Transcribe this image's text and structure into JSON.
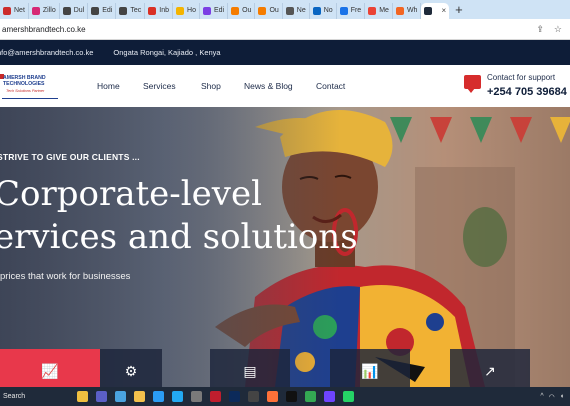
{
  "browser": {
    "tabs": [
      {
        "label": "Net",
        "icon": "tab-favicon",
        "color": "#cc2c2c"
      },
      {
        "label": "Zillo",
        "icon": "tab-favicon",
        "color": "#d62976"
      },
      {
        "label": "Dul",
        "icon": "tab-favicon",
        "color": "#444444"
      },
      {
        "label": "Edi",
        "icon": "tab-favicon",
        "color": "#444444"
      },
      {
        "label": "Tec",
        "icon": "tab-favicon",
        "color": "#444444"
      },
      {
        "label": "Inb",
        "icon": "tab-favicon",
        "color": "#d93025"
      },
      {
        "label": "Ho",
        "icon": "tab-favicon",
        "color": "#f4b400"
      },
      {
        "label": "Edi",
        "icon": "tab-favicon",
        "color": "#7b3fe4"
      },
      {
        "label": "Ou",
        "icon": "tab-favicon",
        "color": "#f57c00"
      },
      {
        "label": "Ou",
        "icon": "tab-favicon",
        "color": "#f57c00"
      },
      {
        "label": "Ne",
        "icon": "tab-favicon",
        "color": "#555555"
      },
      {
        "label": "No",
        "icon": "tab-favicon",
        "color": "#0a66c2"
      },
      {
        "label": "Fre",
        "icon": "tab-favicon",
        "color": "#1a73e8"
      },
      {
        "label": "Me",
        "icon": "tab-favicon",
        "color": "#ea4335"
      },
      {
        "label": "Wh",
        "icon": "tab-favicon",
        "color": "#f26522"
      }
    ],
    "active_tab_close": "×",
    "new_tab": "+",
    "url": "amershbrandtech.co.ke"
  },
  "site": {
    "email": "nfo@amershbrandtech.co.ke",
    "location": "Ongata Rongai, Kajiado , Kenya",
    "logo": {
      "line1": "AMERSH BRAND",
      "line2": "TECHNOLOGIES",
      "tagline": "Tech Solutions Partner"
    },
    "nav": [
      "Home",
      "Services",
      "Shop",
      "News & Blog",
      "Contact"
    ],
    "support": {
      "label": "Contact for support",
      "phone": "+254 705 39684"
    },
    "hero": {
      "eyebrow": "STRIVE TO GIVE OUR CLIENTS ...",
      "headline_line1": "Corporate-level",
      "headline_line2": "ervices and solutions",
      "subtext": "prices that work for businesses"
    },
    "colors": {
      "navy": "#0e1d38",
      "accent_red": "#e8384b"
    }
  },
  "taskbar": {
    "search_label": "Search",
    "apps": [
      {
        "name": "file-explorer-icon",
        "color": "#f0c040"
      },
      {
        "name": "teams-icon",
        "color": "#5b5fc7"
      },
      {
        "name": "store-icon",
        "color": "#4aa3df"
      },
      {
        "name": "folder-icon",
        "color": "#f3c14c"
      },
      {
        "name": "edge-icon",
        "color": "#2b9df4"
      },
      {
        "name": "vscode-icon",
        "color": "#23a9f2"
      },
      {
        "name": "app-icon",
        "color": "#7a7a7a"
      },
      {
        "name": "filezilla-icon",
        "color": "#bf1e2e"
      },
      {
        "name": "photoshop-icon",
        "color": "#0c2a5a"
      },
      {
        "name": "terminal-icon",
        "color": "#444444"
      },
      {
        "name": "firefox-icon",
        "color": "#ff7139"
      },
      {
        "name": "tiktok-icon",
        "color": "#111111"
      },
      {
        "name": "chrome-icon",
        "color": "#34a853"
      },
      {
        "name": "app2-icon",
        "color": "#6e44ff"
      },
      {
        "name": "whatsapp-icon",
        "color": "#25d366"
      }
    ]
  }
}
